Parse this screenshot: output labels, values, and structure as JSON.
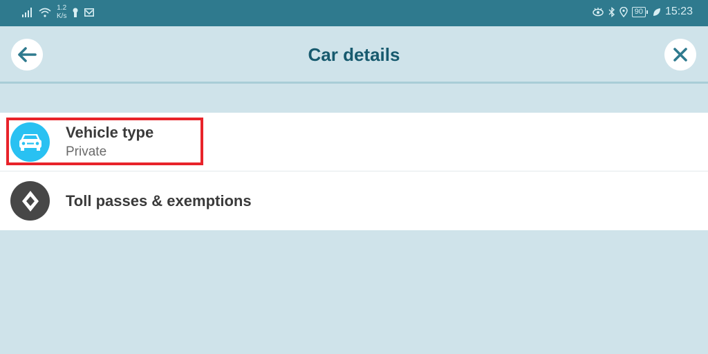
{
  "status_bar": {
    "net_speed_value": "1.2",
    "net_speed_unit": "K/s",
    "battery": "90",
    "time": "15:23",
    "icons_left": [
      "signal-icon",
      "wifi-icon",
      "keyhole-icon",
      "mail-icon"
    ],
    "icons_right": [
      "eye-icon",
      "bluetooth-icon",
      "location-icon",
      "battery-icon",
      "leaf-icon"
    ]
  },
  "header": {
    "title": "Car details",
    "back_icon": "arrow-left-icon",
    "close_icon": "close-icon"
  },
  "list": {
    "items": [
      {
        "title": "Vehicle type",
        "subtitle": "Private",
        "icon": "car-icon",
        "icon_color": "#29c1f2",
        "highlighted": true
      },
      {
        "title": "Toll passes & exemptions",
        "icon": "diamond-icon",
        "icon_color": "#474747"
      }
    ]
  },
  "colors": {
    "status_bar": "#2f7a8e",
    "background": "#cfe3ea",
    "accent": "#175a6e",
    "highlight": "#e8232a"
  }
}
